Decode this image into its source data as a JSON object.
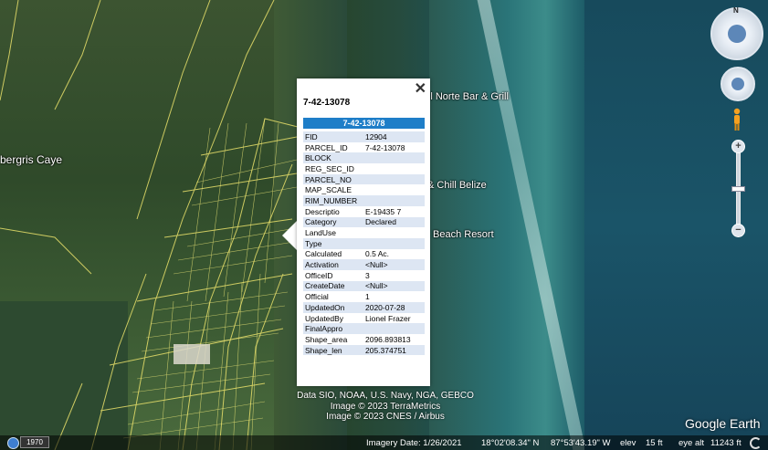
{
  "map_labels": {
    "ambergris": "bergris Caye",
    "norte_bar": "El Norte Bar & Grill",
    "chill": "& Chill Belize",
    "beach_resort": "Beach Resort"
  },
  "popup": {
    "title": "7-42-13078",
    "header": "7-42-13078",
    "close": "✕",
    "rows": [
      {
        "key": "FID",
        "value": "12904"
      },
      {
        "key": "PARCEL_ID",
        "value": "7-42-13078"
      },
      {
        "key": "BLOCK",
        "value": ""
      },
      {
        "key": "REG_SEC_ID",
        "value": ""
      },
      {
        "key": "PARCEL_NO",
        "value": ""
      },
      {
        "key": "MAP_SCALE",
        "value": ""
      },
      {
        "key": "RIM_NUMBER",
        "value": ""
      },
      {
        "key": "Descriptio",
        "value": "E-19435 7"
      },
      {
        "key": "Category",
        "value": "Declared"
      },
      {
        "key": "LandUse",
        "value": ""
      },
      {
        "key": "Type",
        "value": ""
      },
      {
        "key": "Calculated",
        "value": "0.5 Ac."
      },
      {
        "key": "Activation",
        "value": "<Null>"
      },
      {
        "key": "OfficeID",
        "value": "3"
      },
      {
        "key": "CreateDate",
        "value": "<Null>"
      },
      {
        "key": "Official",
        "value": "1"
      },
      {
        "key": "UpdatedOn",
        "value": "2020-07-28"
      },
      {
        "key": "UpdatedBy",
        "value": "Lionel Frazer"
      },
      {
        "key": "FinalAppro",
        "value": ""
      },
      {
        "key": "Shape_area",
        "value": "2096.893813"
      },
      {
        "key": "Shape_len",
        "value": "205.374751"
      }
    ]
  },
  "nav": {
    "north": "N",
    "zoom_in": "+",
    "zoom_out": "−"
  },
  "attribution": {
    "line1": "Data SIO, NOAA, U.S. Navy, NGA, GEBCO",
    "line2": "Image © 2023 TerraMetrics",
    "line3": "Image © 2023 CNES / Airbus"
  },
  "brand": "Google Earth",
  "status": {
    "year": "1970",
    "imagery_date": "Imagery Date: 1/26/2021",
    "lat": "18°02'08.34\" N",
    "lon": "87°53'43.19\" W",
    "elev_label": "elev",
    "elev": "15 ft",
    "eye_label": "eye alt",
    "eye": "11243 ft"
  }
}
